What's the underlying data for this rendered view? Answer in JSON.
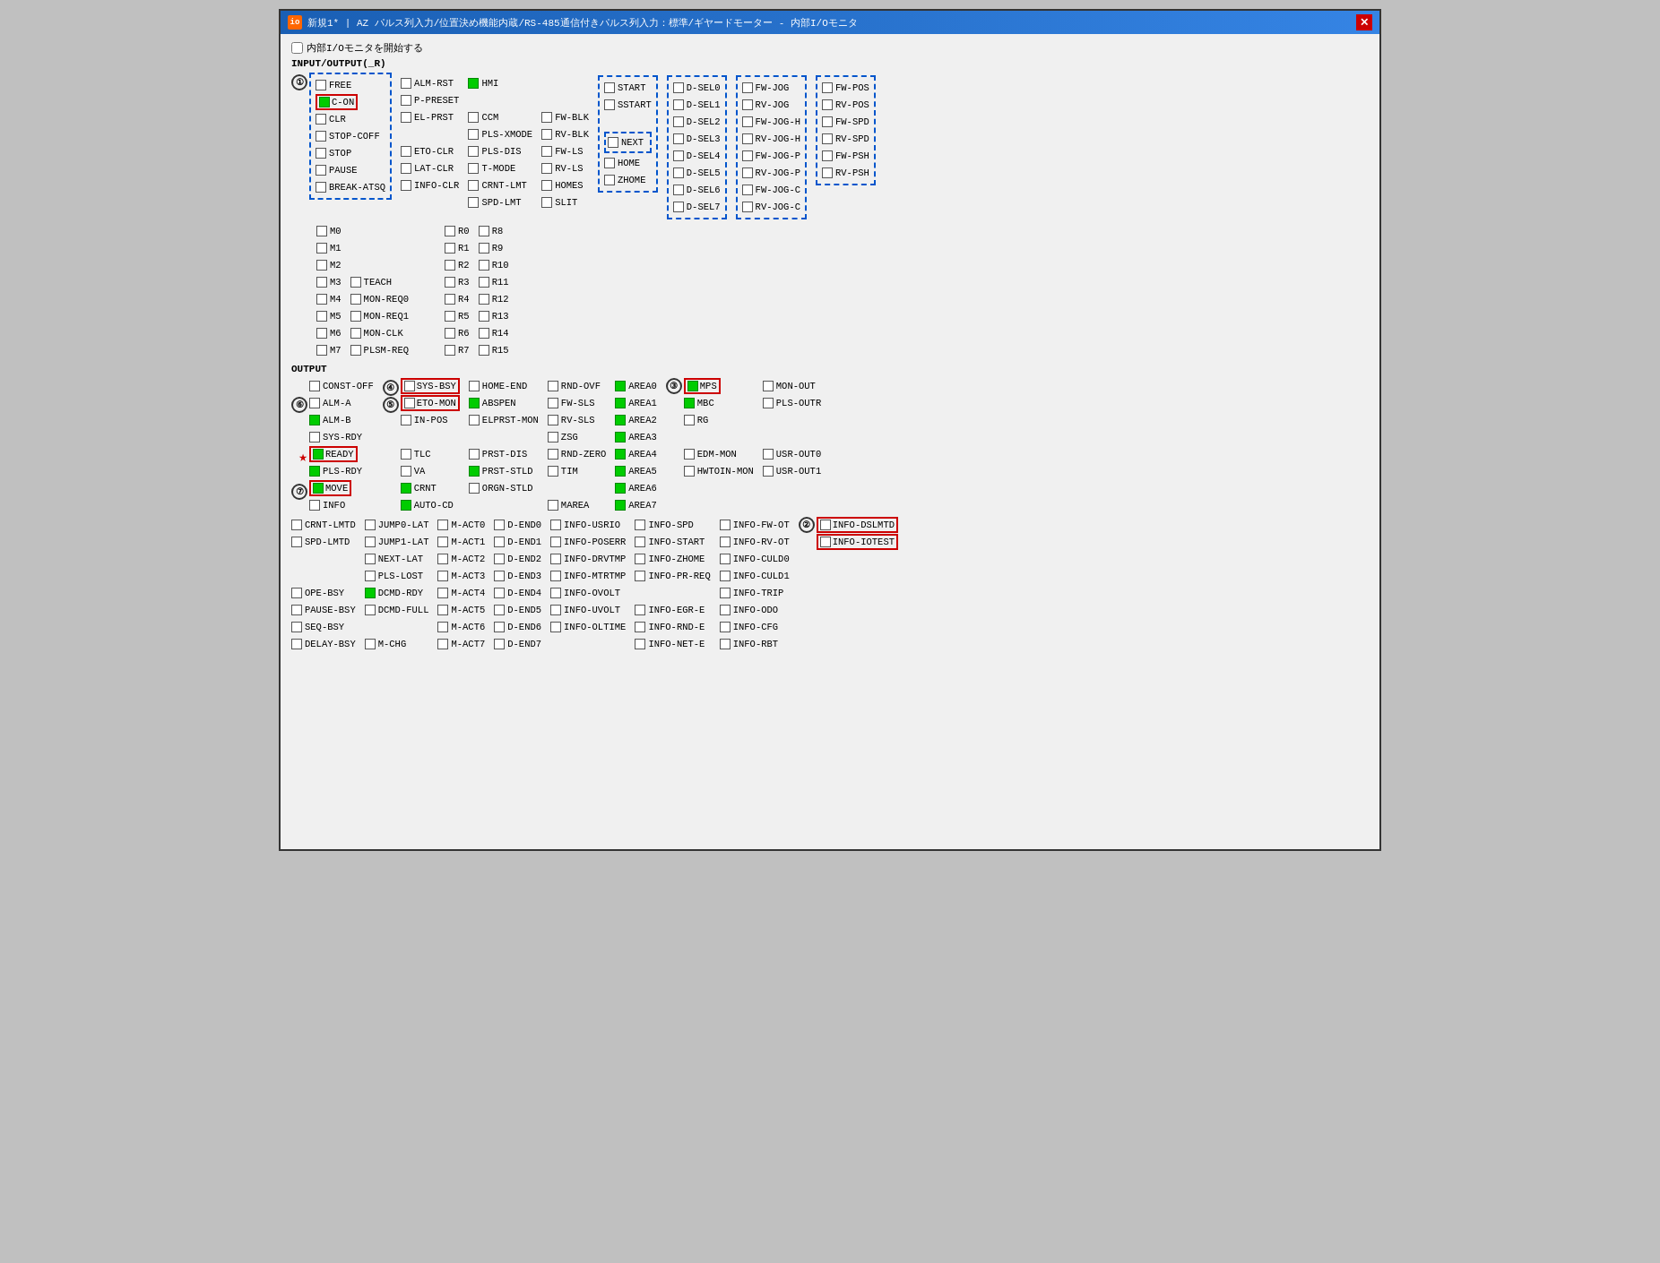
{
  "window": {
    "title": "新規1* | AZ パルス列入力/位置決め機能内蔵/RS-485通信付きパルス列入力：標準/ギヤードモーター - 内部I/Oモニタ",
    "icon_text": "io"
  },
  "header": {
    "checkbox_label": "内部I/Oモニタを開始する",
    "input_output_label": "INPUT/OUTPUT(_R)"
  },
  "input_col1_dashed": {
    "label": "①",
    "items": [
      {
        "text": "FREE",
        "state": "unchecked"
      },
      {
        "text": "C-ON",
        "state": "green",
        "red_border": true
      },
      {
        "text": "CLR",
        "state": "unchecked"
      },
      {
        "text": "STOP-COFF",
        "state": "unchecked"
      },
      {
        "text": "STOP",
        "state": "unchecked"
      },
      {
        "text": "PAUSE",
        "state": "unchecked"
      },
      {
        "text": "BREAK-ATSQ",
        "state": "unchecked"
      }
    ]
  },
  "input_col2": {
    "items": [
      {
        "text": "ALM-RST",
        "state": "unchecked"
      },
      {
        "text": "P-PRESET",
        "state": "unchecked"
      },
      {
        "text": "EL-PRST",
        "state": "unchecked"
      },
      {
        "text": "",
        "state": "empty"
      },
      {
        "text": "ETO-CLR",
        "state": "unchecked"
      },
      {
        "text": "LAT-CLR",
        "state": "unchecked"
      },
      {
        "text": "INFO-CLR",
        "state": "unchecked"
      }
    ]
  },
  "input_col3": {
    "items": [
      {
        "text": "HMI",
        "state": "green"
      },
      {
        "text": "",
        "state": "empty"
      },
      {
        "text": "CCM",
        "state": "unchecked"
      },
      {
        "text": "PLS-XMODE",
        "state": "unchecked"
      },
      {
        "text": "PLS-DIS",
        "state": "unchecked"
      },
      {
        "text": "T-MODE",
        "state": "unchecked"
      },
      {
        "text": "CRNT-LMT",
        "state": "unchecked"
      },
      {
        "text": "SPD-LMT",
        "state": "unchecked"
      }
    ]
  },
  "input_col4": {
    "items": [
      {
        "text": "",
        "state": "empty"
      },
      {
        "text": "",
        "state": "empty"
      },
      {
        "text": "FW-BLK",
        "state": "unchecked"
      },
      {
        "text": "RV-BLK",
        "state": "unchecked"
      },
      {
        "text": "FW-LS",
        "state": "unchecked"
      },
      {
        "text": "RV-LS",
        "state": "unchecked"
      },
      {
        "text": "HOMES",
        "state": "unchecked"
      },
      {
        "text": "SLIT",
        "state": "unchecked"
      }
    ]
  },
  "input_col5_dashed": {
    "items": [
      {
        "text": "START",
        "state": "unchecked"
      },
      {
        "text": "SSTART",
        "state": "unchecked"
      },
      {
        "text": "",
        "state": "empty"
      },
      {
        "text": "NEXT",
        "state": "unchecked",
        "dashed": true
      },
      {
        "text": "HOME",
        "state": "unchecked"
      },
      {
        "text": "ZHOME",
        "state": "unchecked"
      }
    ]
  },
  "input_col6": {
    "items": [
      {
        "text": "D-SEL0",
        "state": "unchecked"
      },
      {
        "text": "D-SEL1",
        "state": "unchecked"
      },
      {
        "text": "D-SEL2",
        "state": "unchecked"
      },
      {
        "text": "D-SEL3",
        "state": "unchecked"
      },
      {
        "text": "D-SEL4",
        "state": "unchecked"
      },
      {
        "text": "D-SEL5",
        "state": "unchecked"
      },
      {
        "text": "D-SEL6",
        "state": "unchecked"
      },
      {
        "text": "D-SEL7",
        "state": "unchecked"
      }
    ]
  },
  "input_col7": {
    "items": [
      {
        "text": "FW-JOG",
        "state": "unchecked"
      },
      {
        "text": "RV-JOG",
        "state": "unchecked"
      },
      {
        "text": "FW-JOG-H",
        "state": "unchecked"
      },
      {
        "text": "RV-JOG-H",
        "state": "unchecked"
      },
      {
        "text": "FW-JOG-P",
        "state": "unchecked"
      },
      {
        "text": "RV-JOG-P",
        "state": "unchecked"
      },
      {
        "text": "FW-JOG-C",
        "state": "unchecked"
      },
      {
        "text": "RV-JOG-C",
        "state": "unchecked"
      }
    ]
  },
  "input_col8": {
    "items": [
      {
        "text": "FW-POS",
        "state": "unchecked"
      },
      {
        "text": "RV-POS",
        "state": "unchecked"
      },
      {
        "text": "FW-SPD",
        "state": "unchecked"
      },
      {
        "text": "RV-SPD",
        "state": "unchecked"
      },
      {
        "text": "FW-PSH",
        "state": "unchecked"
      },
      {
        "text": "RV-PSH",
        "state": "unchecked"
      }
    ]
  },
  "m_col1": {
    "items": [
      {
        "text": "M0",
        "state": "unchecked"
      },
      {
        "text": "M1",
        "state": "unchecked"
      },
      {
        "text": "M2",
        "state": "unchecked"
      },
      {
        "text": "M3",
        "state": "unchecked"
      },
      {
        "text": "M4",
        "state": "unchecked"
      },
      {
        "text": "M5",
        "state": "unchecked"
      },
      {
        "text": "M6",
        "state": "unchecked"
      },
      {
        "text": "M7",
        "state": "unchecked"
      }
    ]
  },
  "m_col2": {
    "items": [
      {
        "text": "",
        "state": "empty"
      },
      {
        "text": "",
        "state": "empty"
      },
      {
        "text": "",
        "state": "empty"
      },
      {
        "text": "TEACH",
        "state": "unchecked"
      },
      {
        "text": "MON-REQ0",
        "state": "unchecked"
      },
      {
        "text": "MON-REQ1",
        "state": "unchecked"
      },
      {
        "text": "MON-CLK",
        "state": "unchecked"
      },
      {
        "text": "PLSM-REQ",
        "state": "unchecked"
      }
    ]
  },
  "r_col1": {
    "items": [
      {
        "text": "R0",
        "state": "unchecked"
      },
      {
        "text": "R1",
        "state": "unchecked"
      },
      {
        "text": "R2",
        "state": "unchecked"
      },
      {
        "text": "R3",
        "state": "unchecked"
      },
      {
        "text": "R4",
        "state": "unchecked"
      },
      {
        "text": "R5",
        "state": "unchecked"
      },
      {
        "text": "R6",
        "state": "unchecked"
      },
      {
        "text": "R7",
        "state": "unchecked"
      }
    ]
  },
  "r_col2": {
    "items": [
      {
        "text": "R8",
        "state": "unchecked"
      },
      {
        "text": "R9",
        "state": "unchecked"
      },
      {
        "text": "R10",
        "state": "unchecked"
      },
      {
        "text": "R11",
        "state": "unchecked"
      },
      {
        "text": "R12",
        "state": "unchecked"
      },
      {
        "text": "R13",
        "state": "unchecked"
      },
      {
        "text": "R14",
        "state": "unchecked"
      },
      {
        "text": "R15",
        "state": "unchecked"
      }
    ]
  },
  "output_label": "OUTPUT",
  "out_col1": {
    "items": [
      {
        "text": "CONST-OFF",
        "state": "unchecked"
      },
      {
        "text": "ALM-A",
        "state": "unchecked",
        "annot": "⑥"
      },
      {
        "text": "ALM-B",
        "state": "green"
      },
      {
        "text": "SYS-RDY",
        "state": "unchecked"
      },
      {
        "text": "READY",
        "state": "green",
        "red_border": true,
        "star": true
      },
      {
        "text": "PLS-RDY",
        "state": "green"
      },
      {
        "text": "MOVE",
        "state": "green",
        "red_border": true,
        "annot": "⑦"
      },
      {
        "text": "INFO",
        "state": "unchecked"
      }
    ]
  },
  "out_col2": {
    "items": [
      {
        "text": "SYS-BSY",
        "state": "unchecked",
        "red_border": true,
        "annot": "④"
      },
      {
        "text": "ETO-MON",
        "state": "unchecked",
        "red_border": true,
        "annot": "⑤"
      },
      {
        "text": "IN-POS",
        "state": "unchecked"
      },
      {
        "text": "",
        "state": "empty"
      },
      {
        "text": "TLC",
        "state": "unchecked"
      },
      {
        "text": "VA",
        "state": "unchecked"
      },
      {
        "text": "CRNT",
        "state": "green"
      },
      {
        "text": "AUTO-CD",
        "state": "green"
      }
    ]
  },
  "out_col3": {
    "items": [
      {
        "text": "HOME-END",
        "state": "unchecked"
      },
      {
        "text": "ABSPEN",
        "state": "green"
      },
      {
        "text": "ELPRST-MON",
        "state": "unchecked"
      },
      {
        "text": "",
        "state": "empty"
      },
      {
        "text": "PRST-DIS",
        "state": "unchecked"
      },
      {
        "text": "PRST-STLD",
        "state": "green"
      },
      {
        "text": "ORGN-STLD",
        "state": "unchecked"
      }
    ]
  },
  "out_col4": {
    "items": [
      {
        "text": "RND-OVF",
        "state": "unchecked"
      },
      {
        "text": "FW-SLS",
        "state": "unchecked"
      },
      {
        "text": "RV-SLS",
        "state": "unchecked"
      },
      {
        "text": "ZSG",
        "state": "unchecked"
      },
      {
        "text": "RND-ZERO",
        "state": "unchecked"
      },
      {
        "text": "TIM",
        "state": "unchecked"
      },
      {
        "text": "",
        "state": "empty"
      },
      {
        "text": "MAREA",
        "state": "unchecked"
      }
    ]
  },
  "out_col5": {
    "items": [
      {
        "text": "AREA0",
        "state": "green"
      },
      {
        "text": "AREA1",
        "state": "green"
      },
      {
        "text": "AREA2",
        "state": "green"
      },
      {
        "text": "AREA3",
        "state": "green"
      },
      {
        "text": "AREA4",
        "state": "green"
      },
      {
        "text": "AREA5",
        "state": "green"
      },
      {
        "text": "AREA6",
        "state": "green"
      },
      {
        "text": "AREA7",
        "state": "green"
      }
    ]
  },
  "out_col6": {
    "items": [
      {
        "text": "MPS",
        "state": "green",
        "red_border": true,
        "annot": "③"
      },
      {
        "text": "MBC",
        "state": "green"
      },
      {
        "text": "RG",
        "state": "unchecked"
      },
      {
        "text": "",
        "state": "empty"
      },
      {
        "text": "EDM-MON",
        "state": "unchecked"
      },
      {
        "text": "HWTOIN-MON",
        "state": "unchecked"
      }
    ]
  },
  "out_col7": {
    "items": [
      {
        "text": "MON-OUT",
        "state": "unchecked"
      },
      {
        "text": "PLS-OUTR",
        "state": "unchecked"
      },
      {
        "text": "",
        "state": "empty"
      },
      {
        "text": "",
        "state": "empty"
      },
      {
        "text": "USR-OUT0",
        "state": "unchecked"
      },
      {
        "text": "USR-OUT1",
        "state": "unchecked"
      }
    ]
  },
  "bottom_col1": {
    "items": [
      {
        "text": "CRNT-LMTD",
        "state": "unchecked"
      },
      {
        "text": "SPD-LMTD",
        "state": "unchecked"
      },
      {
        "text": "",
        "state": "empty"
      },
      {
        "text": "",
        "state": "empty"
      },
      {
        "text": "OPE-BSY",
        "state": "unchecked"
      },
      {
        "text": "PAUSE-BSY",
        "state": "unchecked"
      },
      {
        "text": "SEQ-BSY",
        "state": "unchecked"
      },
      {
        "text": "DELAY-BSY",
        "state": "unchecked"
      }
    ]
  },
  "bottom_col2": {
    "items": [
      {
        "text": "JUMP0-LAT",
        "state": "unchecked"
      },
      {
        "text": "JUMP1-LAT",
        "state": "unchecked"
      },
      {
        "text": "NEXT-LAT",
        "state": "unchecked"
      },
      {
        "text": "PLS-LOST",
        "state": "unchecked"
      },
      {
        "text": "DCMD-RDY",
        "state": "green"
      },
      {
        "text": "DCMD-FULL",
        "state": "unchecked"
      },
      {
        "text": "",
        "state": "empty"
      },
      {
        "text": "M-CHG",
        "state": "unchecked"
      }
    ]
  },
  "bottom_col3": {
    "items": [
      {
        "text": "M-ACT0",
        "state": "unchecked"
      },
      {
        "text": "M-ACT1",
        "state": "unchecked"
      },
      {
        "text": "M-ACT2",
        "state": "unchecked"
      },
      {
        "text": "M-ACT3",
        "state": "unchecked"
      },
      {
        "text": "M-ACT4",
        "state": "unchecked"
      },
      {
        "text": "M-ACT5",
        "state": "unchecked"
      },
      {
        "text": "M-ACT6",
        "state": "unchecked"
      },
      {
        "text": "M-ACT7",
        "state": "unchecked"
      }
    ]
  },
  "bottom_col4": {
    "items": [
      {
        "text": "D-END0",
        "state": "unchecked"
      },
      {
        "text": "D-END1",
        "state": "unchecked"
      },
      {
        "text": "D-END2",
        "state": "unchecked"
      },
      {
        "text": "D-END3",
        "state": "unchecked"
      },
      {
        "text": "D-END4",
        "state": "unchecked"
      },
      {
        "text": "D-END5",
        "state": "unchecked"
      },
      {
        "text": "D-END6",
        "state": "unchecked"
      },
      {
        "text": "D-END7",
        "state": "unchecked"
      }
    ]
  },
  "bottom_col5": {
    "items": [
      {
        "text": "INFO-USRIO",
        "state": "unchecked"
      },
      {
        "text": "INFO-POSERR",
        "state": "unchecked"
      },
      {
        "text": "INFO-DRVTMP",
        "state": "unchecked"
      },
      {
        "text": "INFO-MTRTMP",
        "state": "unchecked"
      },
      {
        "text": "INFO-OVOLT",
        "state": "unchecked"
      },
      {
        "text": "INFO-UVOLT",
        "state": "unchecked"
      },
      {
        "text": "INFO-OLTIME",
        "state": "unchecked"
      }
    ]
  },
  "bottom_col6": {
    "items": [
      {
        "text": "INFO-SPD",
        "state": "unchecked"
      },
      {
        "text": "INFO-START",
        "state": "unchecked"
      },
      {
        "text": "INFO-ZHOME",
        "state": "unchecked"
      },
      {
        "text": "INFO-PR-REQ",
        "state": "unchecked"
      },
      {
        "text": "",
        "state": "empty"
      },
      {
        "text": "INFO-EGR-E",
        "state": "unchecked"
      },
      {
        "text": "INFO-RND-E",
        "state": "unchecked"
      },
      {
        "text": "INFO-NET-E",
        "state": "unchecked"
      }
    ]
  },
  "bottom_col7": {
    "items": [
      {
        "text": "INFO-FW-OT",
        "state": "unchecked"
      },
      {
        "text": "INFO-RV-OT",
        "state": "unchecked"
      },
      {
        "text": "INFO-CULD0",
        "state": "unchecked"
      },
      {
        "text": "INFO-CULD1",
        "state": "unchecked"
      },
      {
        "text": "INFO-TRIP",
        "state": "unchecked"
      },
      {
        "text": "INFO-ODO",
        "state": "unchecked"
      },
      {
        "text": "INFO-CFG",
        "state": "unchecked"
      },
      {
        "text": "INFO-RBT",
        "state": "unchecked"
      }
    ]
  },
  "bottom_col8": {
    "items": [
      {
        "text": "INFO-DSLMTD",
        "state": "unchecked",
        "red_border": true,
        "annot": "②"
      },
      {
        "text": "INFO-IOTEST",
        "state": "unchecked",
        "red_border": true
      }
    ]
  }
}
